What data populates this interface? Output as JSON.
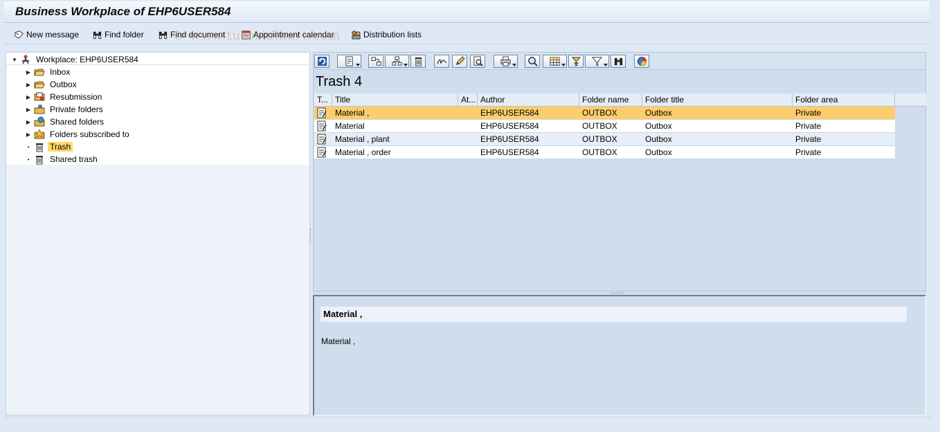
{
  "window": {
    "title": "Business Workplace of EHP6USER584"
  },
  "watermark": "© www.tutorialkart.com",
  "app_toolbar": [
    {
      "label": "New message",
      "icon": "new-message-icon"
    },
    {
      "label": "Find folder",
      "icon": "binoculars-icon"
    },
    {
      "label": "Find document",
      "icon": "binoculars-icon"
    },
    {
      "label": "Appointment calendar",
      "icon": "calendar-icon"
    },
    {
      "label": "Distribution lists",
      "icon": "distribution-list-icon"
    }
  ],
  "tree": {
    "root": "Workplace: EHP6USER584",
    "items": [
      {
        "label": "Inbox",
        "icon": "folder-open-icon"
      },
      {
        "label": "Outbox",
        "icon": "folder-open-icon"
      },
      {
        "label": "Resubmission",
        "icon": "resubmission-icon"
      },
      {
        "label": "Private folders",
        "icon": "private-folder-icon"
      },
      {
        "label": "Shared folders",
        "icon": "shared-folder-icon"
      },
      {
        "label": "Folders subscribed to",
        "icon": "subscribed-folder-icon"
      },
      {
        "label": "Trash",
        "icon": "trash-icon",
        "selected": true
      },
      {
        "label": "Shared trash",
        "icon": "trash-icon"
      }
    ]
  },
  "list": {
    "title": "Trash  4",
    "columns": [
      "T...",
      "Title",
      "At...",
      "Author",
      "Folder name",
      "Folder title",
      "Folder area"
    ],
    "rows": [
      {
        "title": "Material ,",
        "author": "EHP6USER584",
        "folder_name": "OUTBOX",
        "folder_title": "Outbox",
        "folder_area": "Private",
        "selected": true
      },
      {
        "title": "Material",
        "author": "EHP6USER584",
        "folder_name": "OUTBOX",
        "folder_title": "Outbox",
        "folder_area": "Private"
      },
      {
        "title": "Material , plant",
        "author": "EHP6USER584",
        "folder_name": "OUTBOX",
        "folder_title": "Outbox",
        "folder_area": "Private"
      },
      {
        "title": "Material , order",
        "author": "EHP6USER584",
        "folder_name": "OUTBOX",
        "folder_title": "Outbox",
        "folder_area": "Private"
      }
    ]
  },
  "preview": {
    "subject": "Material ,",
    "body": "Material ,"
  },
  "colors": {
    "selection": "#fccd6b",
    "tree_selection": "#ffd966",
    "panel": "#cfddec"
  }
}
